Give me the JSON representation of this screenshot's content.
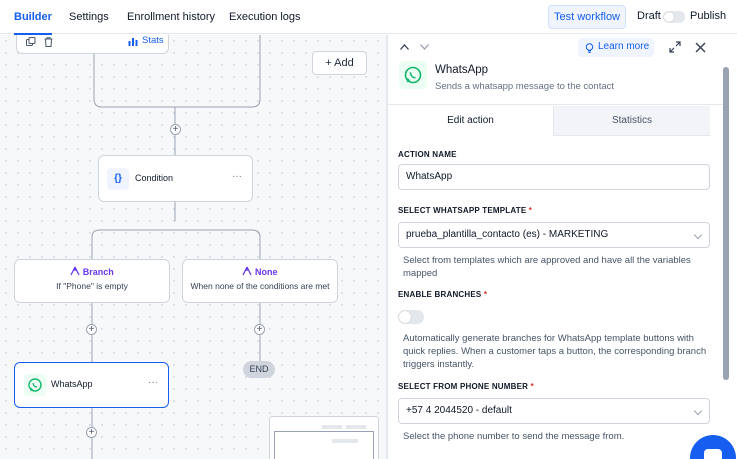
{
  "nav": {
    "tabs": [
      "Builder",
      "Settings",
      "Enrollment history",
      "Execution logs"
    ],
    "test_workflow": "Test workflow",
    "draft": "Draft",
    "publish": "Publish"
  },
  "canvas": {
    "stats_label": "Stats",
    "add_label": "Add",
    "condition_label": "Condition",
    "menu_glyph": "···",
    "branch1_title": "Branch",
    "branch1_sub": "If \"Phone\" is empty",
    "branch2_title": "None",
    "branch2_sub": "When none of the conditions are met",
    "whatsapp_node": "WhatsApp",
    "end_label": "END",
    "plus": "+"
  },
  "panel": {
    "learn_more": "Learn more",
    "title": "WhatsApp",
    "subtitle": "Sends a whatsapp message to the contact",
    "tabs": [
      "Edit action",
      "Statistics"
    ],
    "action_name_label": "ACTION NAME",
    "action_name_value": "WhatsApp",
    "template_label": "SELECT WHATSAPP TEMPLATE",
    "template_value": "prueba_plantilla_contacto (es) - MARKETING",
    "template_help_1": "Select from templates which are approved and have all the variables",
    "template_help_2": "mapped",
    "branches_label": "ENABLE BRANCHES",
    "branches_help_1": "Automatically generate branches for WhatsApp template buttons with",
    "branches_help_2": "quick replies. When a customer taps a button, the corresponding branch",
    "branches_help_3": "triggers instantly.",
    "phone_label": "SELECT FROM PHONE NUMBER",
    "phone_value": "+57 4 2044520 - default",
    "phone_help": "Select the phone number to send the message from.",
    "required_mark": "*"
  },
  "colors": {
    "accent": "#155eef",
    "branch_purple": "#6938ef",
    "whatsapp_green": "#25d366"
  }
}
